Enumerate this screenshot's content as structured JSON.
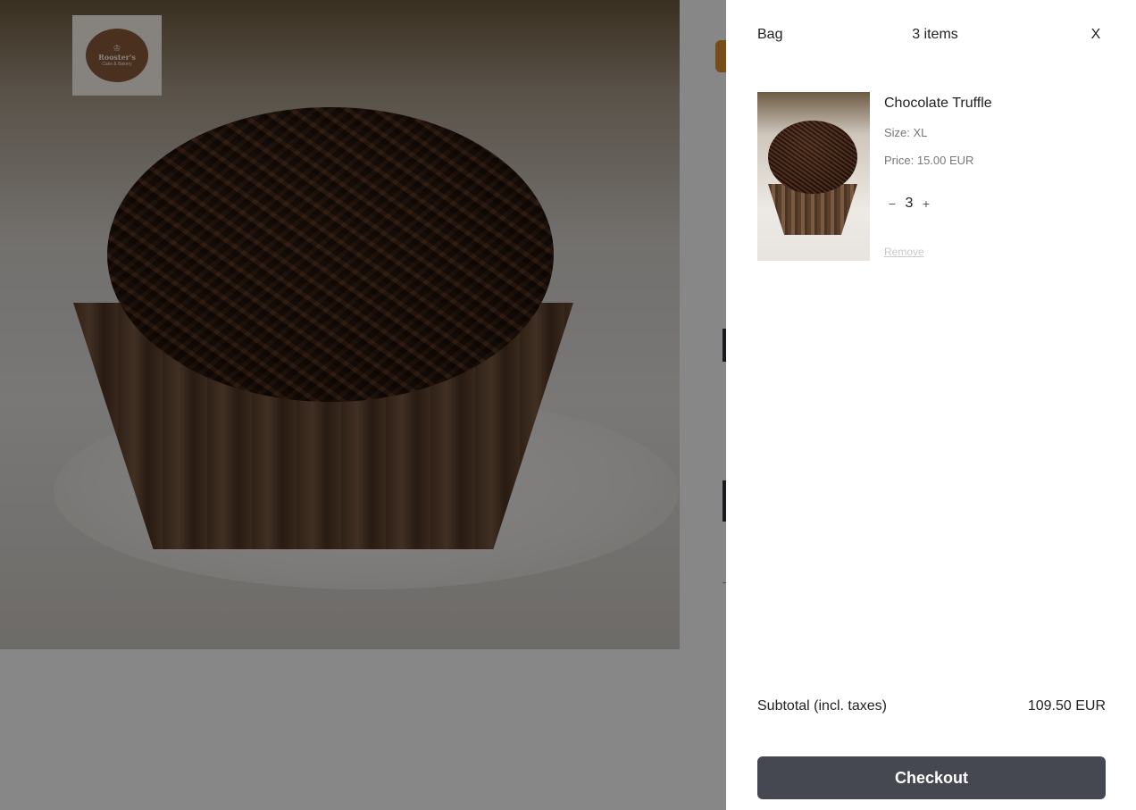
{
  "background": {
    "logo": {
      "name": "Rooster's",
      "tagline": "Cake & Bakery"
    }
  },
  "cart": {
    "title": "Bag",
    "count": "3 items",
    "close_label": "X",
    "items": [
      {
        "name": "Chocolate Truffle",
        "size": "Size: XL",
        "price": "Price: 15.00 EUR",
        "quantity": "3",
        "decrease_label": "−",
        "increase_label": "+",
        "remove_label": "Remove"
      }
    ],
    "subtotal_label": "Subtotal (incl. taxes)",
    "subtotal_value": "109.50 EUR",
    "checkout_label": "Checkout"
  },
  "colors": {
    "checkout_button": "#454850",
    "brand_brown": "#8a5c3b",
    "accent_orange": "#e0902c",
    "overlay": "rgba(0,0,0,0.47)"
  }
}
